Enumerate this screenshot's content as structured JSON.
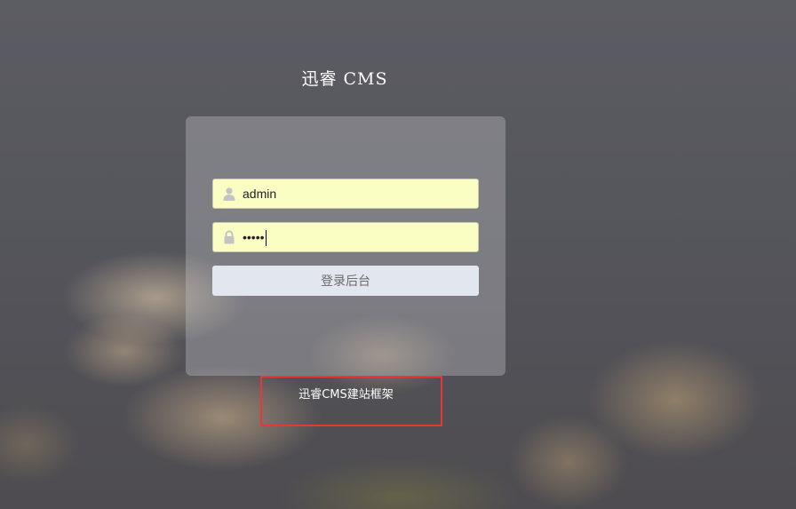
{
  "header": {
    "title": "迅睿 CMS"
  },
  "login": {
    "username_value": "admin",
    "password_masked": "•••••",
    "submit_label": "登录后台",
    "icons": {
      "username": "user-icon",
      "password": "lock-icon"
    }
  },
  "footer": {
    "text": "迅睿CMS建站框架"
  },
  "colors": {
    "input_bg": "#fafec3",
    "button_bg": "#e2e6ee",
    "highlight": "#e53935"
  }
}
